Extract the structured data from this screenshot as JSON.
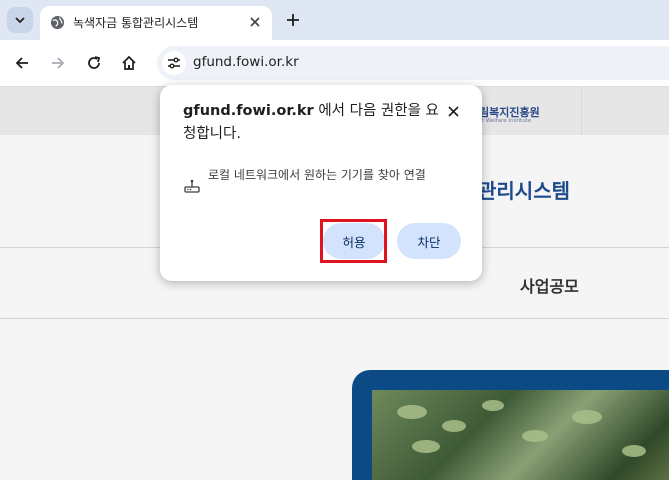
{
  "browser": {
    "tab": {
      "title": "녹색자금 통합관리시스템"
    },
    "address_bar": {
      "url": "gfund.fowi.or.kr"
    }
  },
  "page": {
    "logo": {
      "name": "림복지진흥원",
      "subtitle": "st Welfare Institute"
    },
    "system_title": "관리시스템",
    "menu": {
      "item": "사업공모"
    }
  },
  "dialog": {
    "host": "gfund.fowi.or.kr",
    "title_suffix": " 에서 다음 권한을 요청합니다.",
    "permission_text": "로컬 네트워크에서 원하는 기기를 찾아 연결",
    "allow_label": "허용",
    "block_label": "차단"
  },
  "colors": {
    "accent": "#1e4a8c",
    "button_bg": "#d3e3fd",
    "highlight": "#e0141e",
    "tabstrip": "#dfe7f5"
  },
  "icons": [
    "tab-menu-icon",
    "globe-icon",
    "close-icon",
    "plus-icon",
    "back-icon",
    "forward-icon",
    "reload-icon",
    "home-icon",
    "site-settings-icon",
    "network-device-icon"
  ]
}
